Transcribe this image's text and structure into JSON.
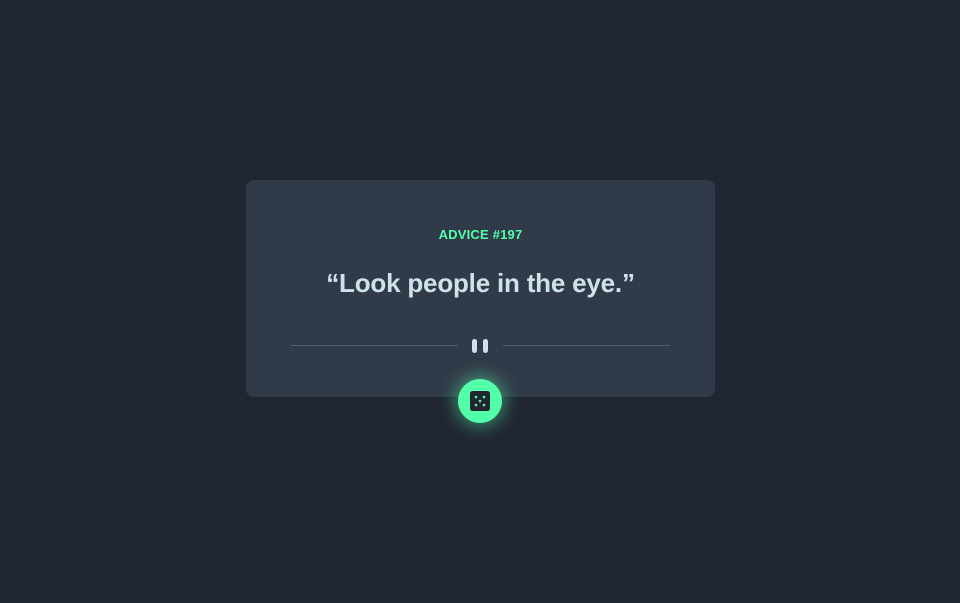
{
  "advice": {
    "id_label": "ADVICE #197",
    "quote": "“Look people in the eye.”"
  },
  "divider": {
    "icon": "pause-icon"
  },
  "button": {
    "icon": "dice-icon",
    "action": "generate-new-advice"
  },
  "colors": {
    "background": "#202632",
    "card": "#313a48",
    "accent": "#53ffaa",
    "text": "#cee3e9",
    "divider": "#4f5d74"
  }
}
